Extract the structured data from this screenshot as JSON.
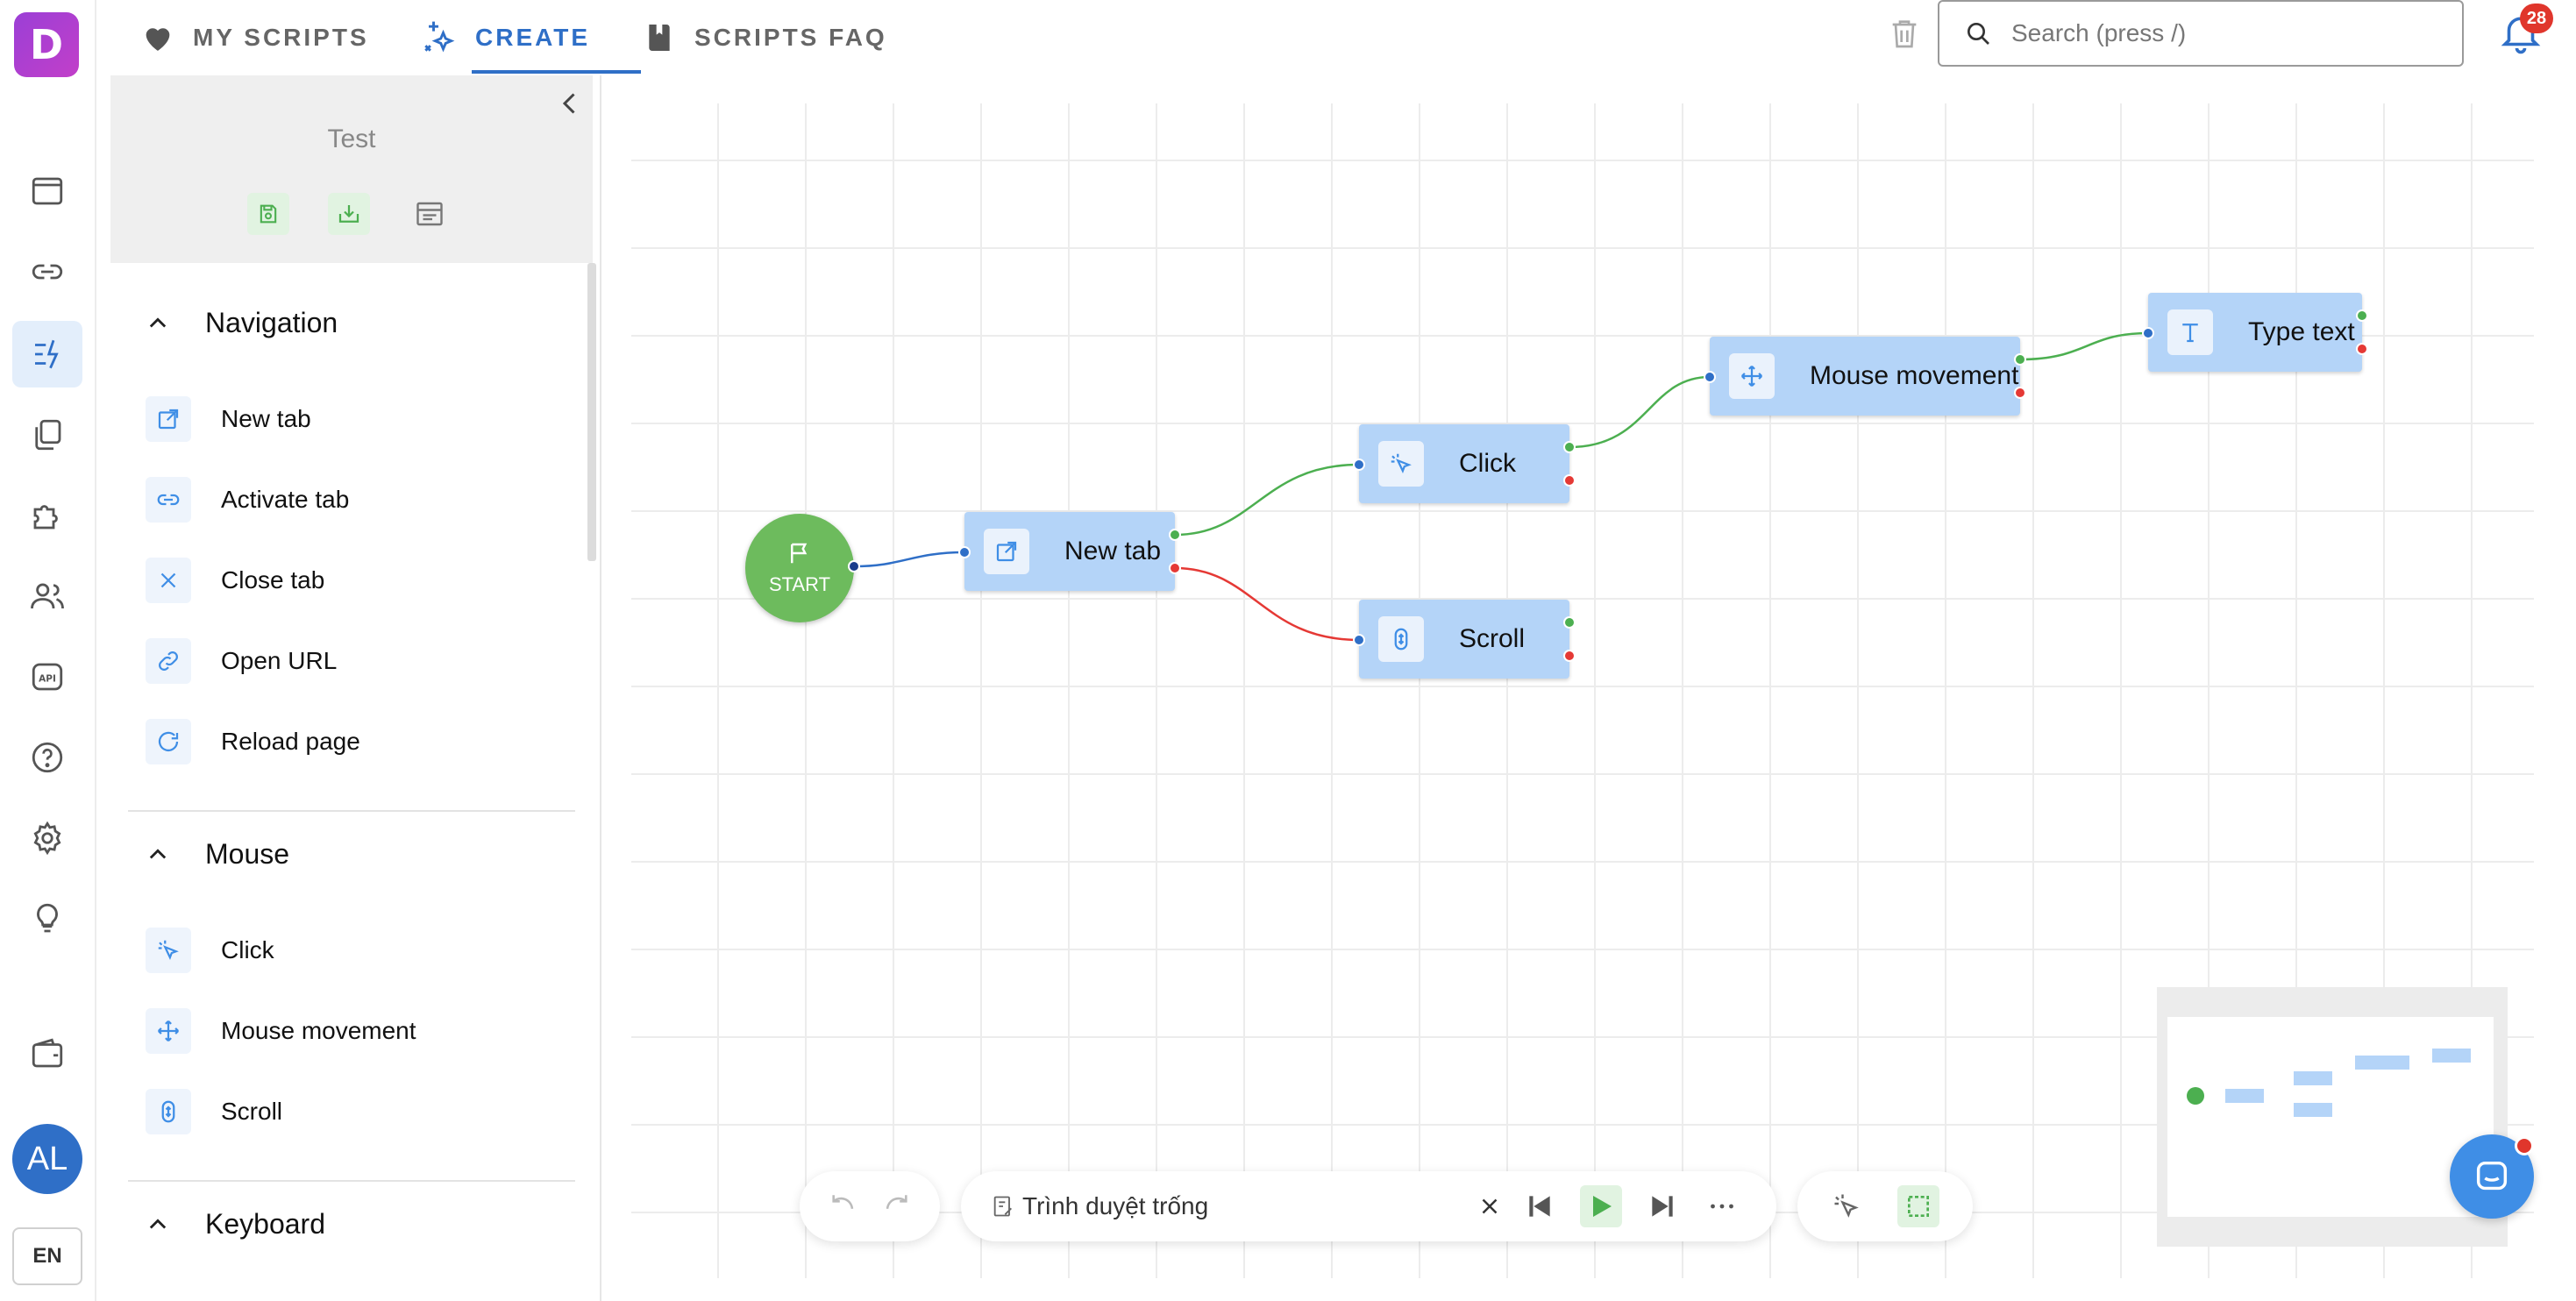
{
  "logo": {
    "letter": "D"
  },
  "user": {
    "initials": "AL",
    "language": "EN"
  },
  "tabs": [
    {
      "label": "MY SCRIPTS",
      "icon": "heart-icon"
    },
    {
      "label": "CREATE",
      "icon": "sparkle-icon"
    },
    {
      "label": "SCRIPTS FAQ",
      "icon": "book-icon"
    }
  ],
  "search": {
    "placeholder": "Search (press /)"
  },
  "notifications": {
    "count": "28"
  },
  "panel": {
    "title": "Test",
    "sections": [
      {
        "title": "Navigation",
        "items": [
          "New tab",
          "Activate tab",
          "Close tab",
          "Open URL",
          "Reload page"
        ]
      },
      {
        "title": "Mouse",
        "items": [
          "Click",
          "Mouse movement",
          "Scroll"
        ]
      },
      {
        "title": "Keyboard",
        "items": []
      }
    ]
  },
  "flow": {
    "start_label": "START",
    "nodes": [
      {
        "label": "New tab",
        "icon": "external-link-icon"
      },
      {
        "label": "Click",
        "icon": "cursor-click-icon"
      },
      {
        "label": "Scroll",
        "icon": "scroll-mouse-icon"
      },
      {
        "label": "Mouse movement",
        "icon": "move-arrows-icon"
      },
      {
        "label": "Type text",
        "icon": "text-t-icon"
      }
    ]
  },
  "toolbar": {
    "profile_text": "Trình duyệt trống"
  },
  "colors": {
    "accent": "#2f6fc7",
    "node": "#b4d4f8",
    "start": "#6dbb5d",
    "success": "#4caf50",
    "error": "#e53935"
  }
}
